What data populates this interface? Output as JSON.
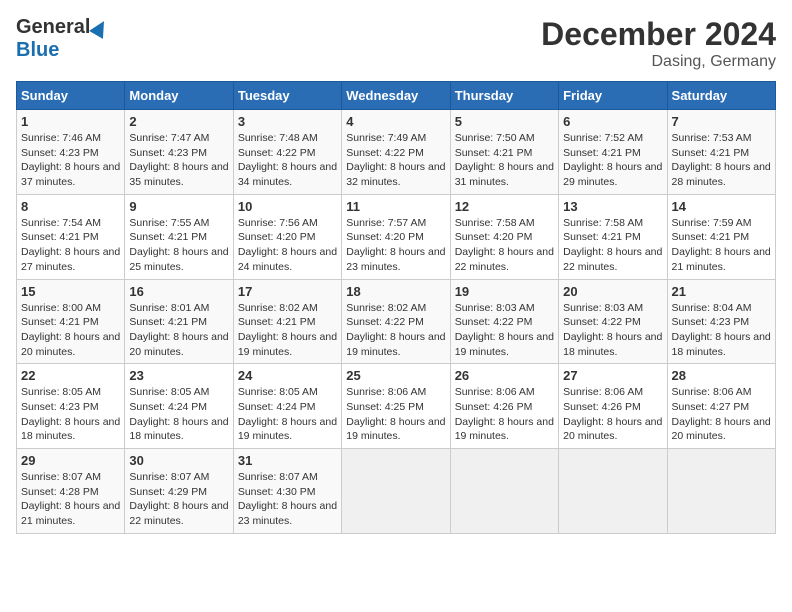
{
  "header": {
    "logo_general": "General",
    "logo_blue": "Blue",
    "month": "December 2024",
    "location": "Dasing, Germany"
  },
  "weekdays": [
    "Sunday",
    "Monday",
    "Tuesday",
    "Wednesday",
    "Thursday",
    "Friday",
    "Saturday"
  ],
  "weeks": [
    [
      {
        "day": "1",
        "sunrise": "7:46 AM",
        "sunset": "4:23 PM",
        "daylight": "8 hours and 37 minutes."
      },
      {
        "day": "2",
        "sunrise": "7:47 AM",
        "sunset": "4:23 PM",
        "daylight": "8 hours and 35 minutes."
      },
      {
        "day": "3",
        "sunrise": "7:48 AM",
        "sunset": "4:22 PM",
        "daylight": "8 hours and 34 minutes."
      },
      {
        "day": "4",
        "sunrise": "7:49 AM",
        "sunset": "4:22 PM",
        "daylight": "8 hours and 32 minutes."
      },
      {
        "day": "5",
        "sunrise": "7:50 AM",
        "sunset": "4:21 PM",
        "daylight": "8 hours and 31 minutes."
      },
      {
        "day": "6",
        "sunrise": "7:52 AM",
        "sunset": "4:21 PM",
        "daylight": "8 hours and 29 minutes."
      },
      {
        "day": "7",
        "sunrise": "7:53 AM",
        "sunset": "4:21 PM",
        "daylight": "8 hours and 28 minutes."
      }
    ],
    [
      {
        "day": "8",
        "sunrise": "7:54 AM",
        "sunset": "4:21 PM",
        "daylight": "8 hours and 27 minutes."
      },
      {
        "day": "9",
        "sunrise": "7:55 AM",
        "sunset": "4:21 PM",
        "daylight": "8 hours and 25 minutes."
      },
      {
        "day": "10",
        "sunrise": "7:56 AM",
        "sunset": "4:20 PM",
        "daylight": "8 hours and 24 minutes."
      },
      {
        "day": "11",
        "sunrise": "7:57 AM",
        "sunset": "4:20 PM",
        "daylight": "8 hours and 23 minutes."
      },
      {
        "day": "12",
        "sunrise": "7:58 AM",
        "sunset": "4:20 PM",
        "daylight": "8 hours and 22 minutes."
      },
      {
        "day": "13",
        "sunrise": "7:58 AM",
        "sunset": "4:21 PM",
        "daylight": "8 hours and 22 minutes."
      },
      {
        "day": "14",
        "sunrise": "7:59 AM",
        "sunset": "4:21 PM",
        "daylight": "8 hours and 21 minutes."
      }
    ],
    [
      {
        "day": "15",
        "sunrise": "8:00 AM",
        "sunset": "4:21 PM",
        "daylight": "8 hours and 20 minutes."
      },
      {
        "day": "16",
        "sunrise": "8:01 AM",
        "sunset": "4:21 PM",
        "daylight": "8 hours and 20 minutes."
      },
      {
        "day": "17",
        "sunrise": "8:02 AM",
        "sunset": "4:21 PM",
        "daylight": "8 hours and 19 minutes."
      },
      {
        "day": "18",
        "sunrise": "8:02 AM",
        "sunset": "4:22 PM",
        "daylight": "8 hours and 19 minutes."
      },
      {
        "day": "19",
        "sunrise": "8:03 AM",
        "sunset": "4:22 PM",
        "daylight": "8 hours and 19 minutes."
      },
      {
        "day": "20",
        "sunrise": "8:03 AM",
        "sunset": "4:22 PM",
        "daylight": "8 hours and 18 minutes."
      },
      {
        "day": "21",
        "sunrise": "8:04 AM",
        "sunset": "4:23 PM",
        "daylight": "8 hours and 18 minutes."
      }
    ],
    [
      {
        "day": "22",
        "sunrise": "8:05 AM",
        "sunset": "4:23 PM",
        "daylight": "8 hours and 18 minutes."
      },
      {
        "day": "23",
        "sunrise": "8:05 AM",
        "sunset": "4:24 PM",
        "daylight": "8 hours and 18 minutes."
      },
      {
        "day": "24",
        "sunrise": "8:05 AM",
        "sunset": "4:24 PM",
        "daylight": "8 hours and 19 minutes."
      },
      {
        "day": "25",
        "sunrise": "8:06 AM",
        "sunset": "4:25 PM",
        "daylight": "8 hours and 19 minutes."
      },
      {
        "day": "26",
        "sunrise": "8:06 AM",
        "sunset": "4:26 PM",
        "daylight": "8 hours and 19 minutes."
      },
      {
        "day": "27",
        "sunrise": "8:06 AM",
        "sunset": "4:26 PM",
        "daylight": "8 hours and 20 minutes."
      },
      {
        "day": "28",
        "sunrise": "8:06 AM",
        "sunset": "4:27 PM",
        "daylight": "8 hours and 20 minutes."
      }
    ],
    [
      {
        "day": "29",
        "sunrise": "8:07 AM",
        "sunset": "4:28 PM",
        "daylight": "8 hours and 21 minutes."
      },
      {
        "day": "30",
        "sunrise": "8:07 AM",
        "sunset": "4:29 PM",
        "daylight": "8 hours and 22 minutes."
      },
      {
        "day": "31",
        "sunrise": "8:07 AM",
        "sunset": "4:30 PM",
        "daylight": "8 hours and 23 minutes."
      },
      null,
      null,
      null,
      null
    ]
  ]
}
